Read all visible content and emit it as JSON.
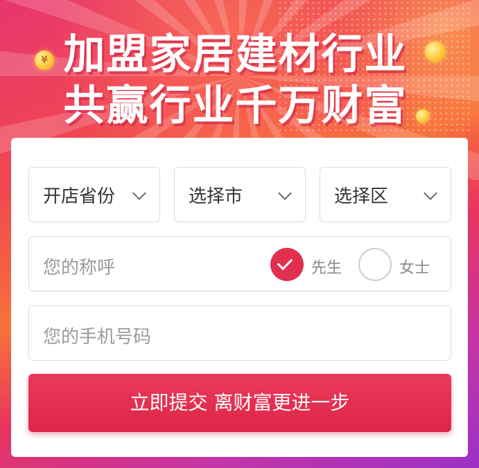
{
  "banner": {
    "headline_line1": "加盟家居建材行业",
    "headline_line2": "共赢行业千万财富",
    "coin_symbol": "¥",
    "colors": {
      "primary": "#e0304e",
      "gradient_top": "#f0484f",
      "gradient_bottom": "#9a32c6"
    }
  },
  "form": {
    "province_select": "开店省份",
    "city_select": "选择市",
    "district_select": "选择区",
    "name_placeholder": "您的称呼",
    "gender_options": [
      {
        "label": "先生",
        "selected": true
      },
      {
        "label": "女士",
        "selected": false
      }
    ],
    "phone_placeholder": "您的手机号码",
    "submit_label": "立即提交 离财富更进一步"
  }
}
